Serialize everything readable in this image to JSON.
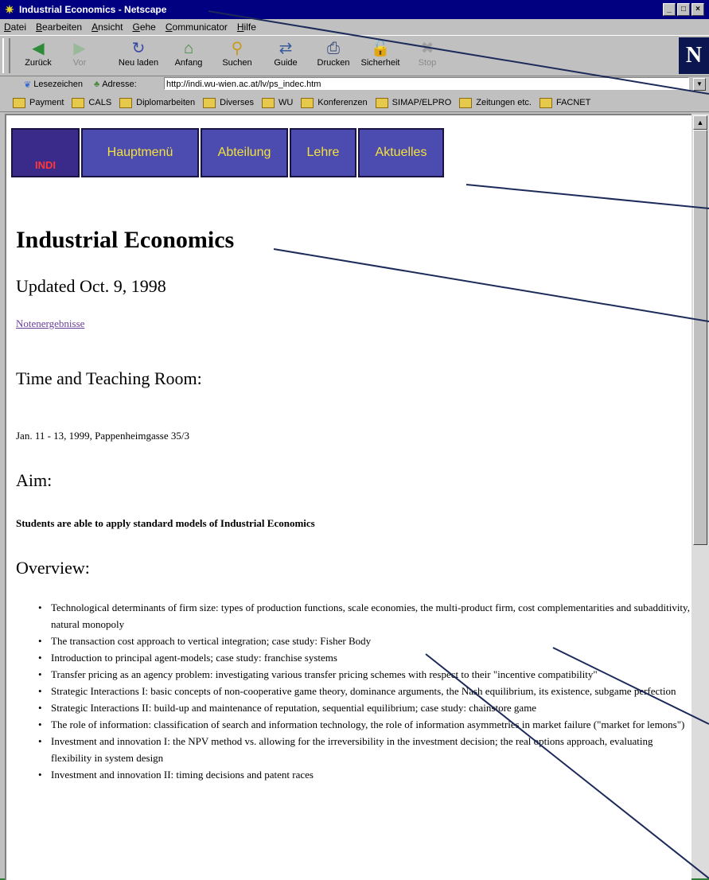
{
  "window": {
    "title": "Industrial Economics - Netscape",
    "controls": [
      "_",
      "□",
      "×"
    ]
  },
  "menu": [
    "Datei",
    "Bearbeiten",
    "Ansicht",
    "Gehe",
    "Communicator",
    "Hilfe"
  ],
  "toolbar": [
    {
      "label": "Zurück",
      "icon": "back-arrow-icon",
      "glyph": "◀",
      "disabled": false
    },
    {
      "label": "Vor",
      "icon": "forward-arrow-icon",
      "glyph": "▶",
      "disabled": true
    },
    {
      "label": "Neu laden",
      "icon": "reload-icon",
      "glyph": "↻",
      "disabled": false
    },
    {
      "label": "Anfang",
      "icon": "home-icon",
      "glyph": "⌂",
      "disabled": false
    },
    {
      "label": "Suchen",
      "icon": "search-icon",
      "glyph": "⚲",
      "disabled": false
    },
    {
      "label": "Guide",
      "icon": "guide-icon",
      "glyph": "⇄",
      "disabled": false
    },
    {
      "label": "Drucken",
      "icon": "print-icon",
      "glyph": "⎙",
      "disabled": false
    },
    {
      "label": "Sicherheit",
      "icon": "lock-icon",
      "glyph": "🔓",
      "disabled": false
    },
    {
      "label": "Stop",
      "icon": "stop-icon",
      "glyph": "✖",
      "disabled": true
    }
  ],
  "logo": "N",
  "location": {
    "bookmarks_label": "Lesezeichen",
    "address_label": "Adresse:",
    "url": "http://indi.wu-wien.ac.at/lv/ps_indec.htm"
  },
  "personal_toolbar": [
    "Payment",
    "CALS",
    "Diplomarbeiten",
    "Diverses",
    "WU",
    "Konferenzen",
    "SIMAP/ELPRO",
    "Zeitungen etc.",
    "FACNET"
  ],
  "page": {
    "logo_text": "INDI",
    "nav": [
      "Hauptmenü",
      "Abteilung",
      "Lehre",
      "Aktuelles"
    ],
    "title": "Industrial Economics",
    "updated": "Updated Oct. 9, 1998",
    "link": "Notenergebnisse",
    "time_heading": "Time and Teaching Room:",
    "time_text": "Jan. 11 - 13, 1999, Pappenheimgasse 35/3",
    "aim_heading": "Aim:",
    "aim_text": "Students are able to apply standard models of Industrial Economics",
    "overview_heading": "Overview:",
    "overview": [
      "Technological determinants of firm size: types of production functions, scale economies, the multi-product firm, cost complementarities and subadditivity, natural monopoly",
      "The transaction cost approach to vertical integration; case study: Fisher Body",
      "Introduction to principal agent-models; case study: franchise systems",
      "Transfer pricing as an agency problem: investigating various transfer pricing schemes with respect to their \"incentive compatibility\"",
      "Strategic Interactions I: basic concepts of non-cooperative game theory, dominance arguments, the Nash equilibrium, its existence, subgame perfection",
      "Strategic Interactions II: build-up and maintenance of reputation, sequential equilibrium; case study: chainstore game",
      "The role of information: classification of search and information technology, the role of information asymmetries in market failure (\"market for lemons\")",
      "Investment and innovation I: the NPV method vs. allowing for the irreversibility in the investment decision; the real options approach, evaluating flexibility in system design",
      "Investment and innovation II: timing decisions and patent races"
    ]
  },
  "colors": {
    "title_bar": "#000080",
    "page_bg": "#2f7f3a",
    "nav_button": "#4b4bb0",
    "nav_text": "#f4e23a",
    "link": "#6a3f9a"
  }
}
